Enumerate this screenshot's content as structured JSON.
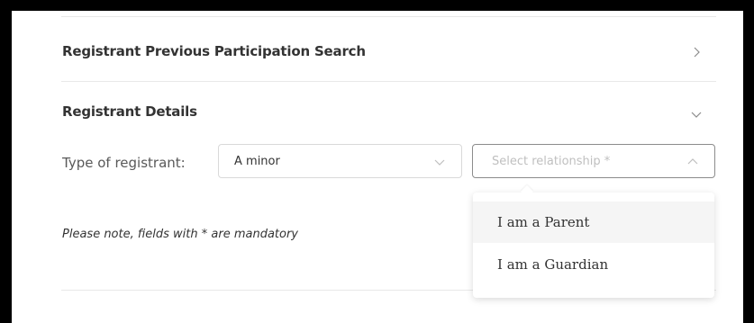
{
  "sections": [
    {
      "title": "Registrant Previous Participation Search",
      "icon": "chevron-right-icon"
    },
    {
      "title": "Registrant Details",
      "icon": "chevron-down-icon"
    }
  ],
  "form": {
    "type_label": "Type of registrant:",
    "type_value": "A minor",
    "relationship_placeholder": "Select relationship *",
    "note": "Please note, fields with * are mandatory"
  },
  "dropdown": {
    "options": [
      "I am a Parent",
      "I am a Guardian"
    ],
    "hovered_index": 0
  },
  "colors": {
    "border": "#d9d9d9",
    "placeholder": "#bfbfbf",
    "hover": "#f5f5f5",
    "frame": "#000000"
  }
}
